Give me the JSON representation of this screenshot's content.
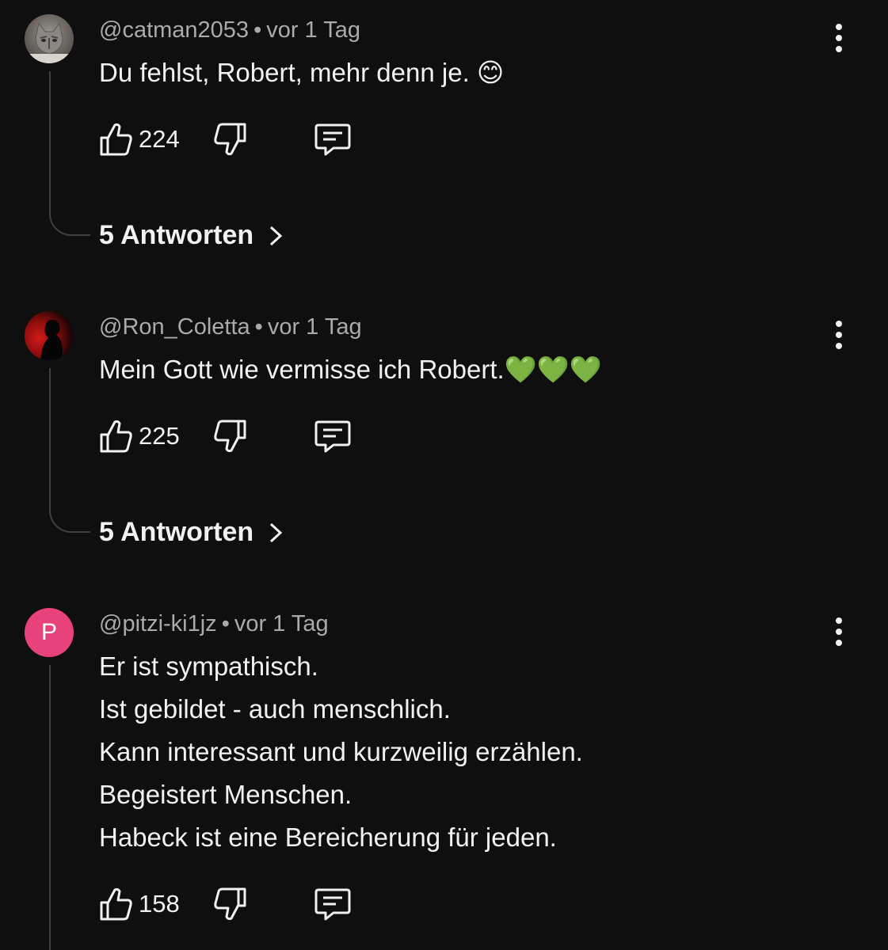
{
  "comments": [
    {
      "handle": "@catman2053",
      "separator": "•",
      "time": "vor 1 Tag",
      "lines": [
        "Du fehlst, Robert, mehr denn je. 😊"
      ],
      "likes": "224",
      "replies": "5 Antworten",
      "avatar": "cat-photo"
    },
    {
      "handle": "@Ron_Coletta",
      "separator": "•",
      "time": "vor 1 Tag",
      "lines": [
        "Mein Gott wie vermisse ich Robert.💚💚💚"
      ],
      "likes": "225",
      "replies": "5 Antworten",
      "avatar": "red-silhouette"
    },
    {
      "handle": "@pitzi-ki1jz",
      "separator": "•",
      "time": "vor 1 Tag",
      "lines": [
        "Er ist sympathisch.",
        "Ist gebildet - auch menschlich.",
        "Kann interessant und kurzweilig erzählen.",
        "Begeistert Menschen.",
        "Habeck ist eine Bereicherung für jeden."
      ],
      "likes": "158",
      "avatar_letter": "P",
      "avatar_color": "#e8427c"
    }
  ],
  "colors": {
    "background": "#0f0f0f",
    "meta": "#aaaaaa",
    "text": "#f1f1f1",
    "thread_line": "#3f3f3f"
  }
}
